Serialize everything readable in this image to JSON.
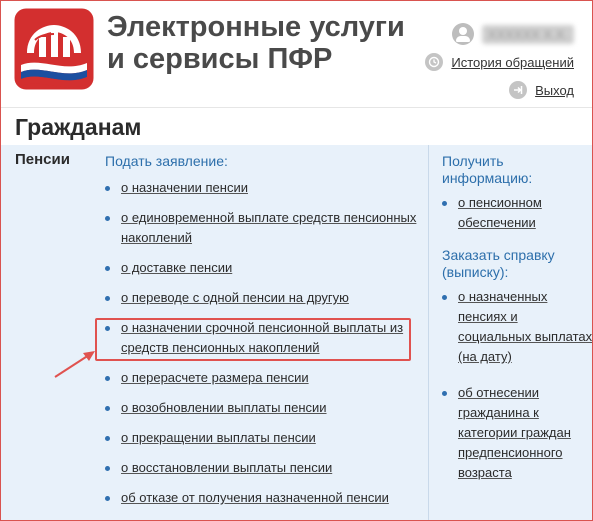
{
  "header": {
    "title_line1": "Электронные услуги",
    "title_line2": "и сервисы ПФР",
    "user_name": "ХХХХХХ Х.Х.",
    "history_link": "История обращений",
    "exit_link": "Выход"
  },
  "section": {
    "title": "Гражданам"
  },
  "left": {
    "label": "Пенсии"
  },
  "middle": {
    "heading": "Подать заявление:",
    "items": [
      {
        "label": "о назначении пенсии"
      },
      {
        "label": "о единовременной выплате средств пенсионных накоплений"
      },
      {
        "label": "о доставке пенсии"
      },
      {
        "label": "о переводе с одной пенсии на другую"
      },
      {
        "label": "о назначении срочной пенсионной выплаты из средств пенсионных накоплений",
        "highlighted": true
      },
      {
        "label": "о перерасчете размера пенсии"
      },
      {
        "label": "о возобновлении выплаты пенсии"
      },
      {
        "label": "о прекращении выплаты пенсии"
      },
      {
        "label": "о восстановлении выплаты пенсии"
      },
      {
        "label": "об отказе от получения назначенной пенсии"
      }
    ]
  },
  "right": {
    "info_heading": "Получить информацию:",
    "info_items": [
      {
        "label": "о пенсионном обеспечении"
      }
    ],
    "order_heading": "Заказать справку (выписку):",
    "order_items": [
      {
        "label": "о назначенных пенсиях и социальных выплатах (на дату)"
      },
      {
        "label": "об отнесении гражданина к категории граждан предпенсионного возраста"
      }
    ]
  },
  "colors": {
    "accent_blue": "#2d6fab",
    "highlight_red": "#e0524f",
    "content_bg": "#e8f1fa",
    "logo_red": "#d32f2f",
    "logo_blue": "#1c4fa0"
  },
  "icons": {
    "user": "user-icon",
    "history": "history-icon",
    "exit": "exit-icon"
  }
}
